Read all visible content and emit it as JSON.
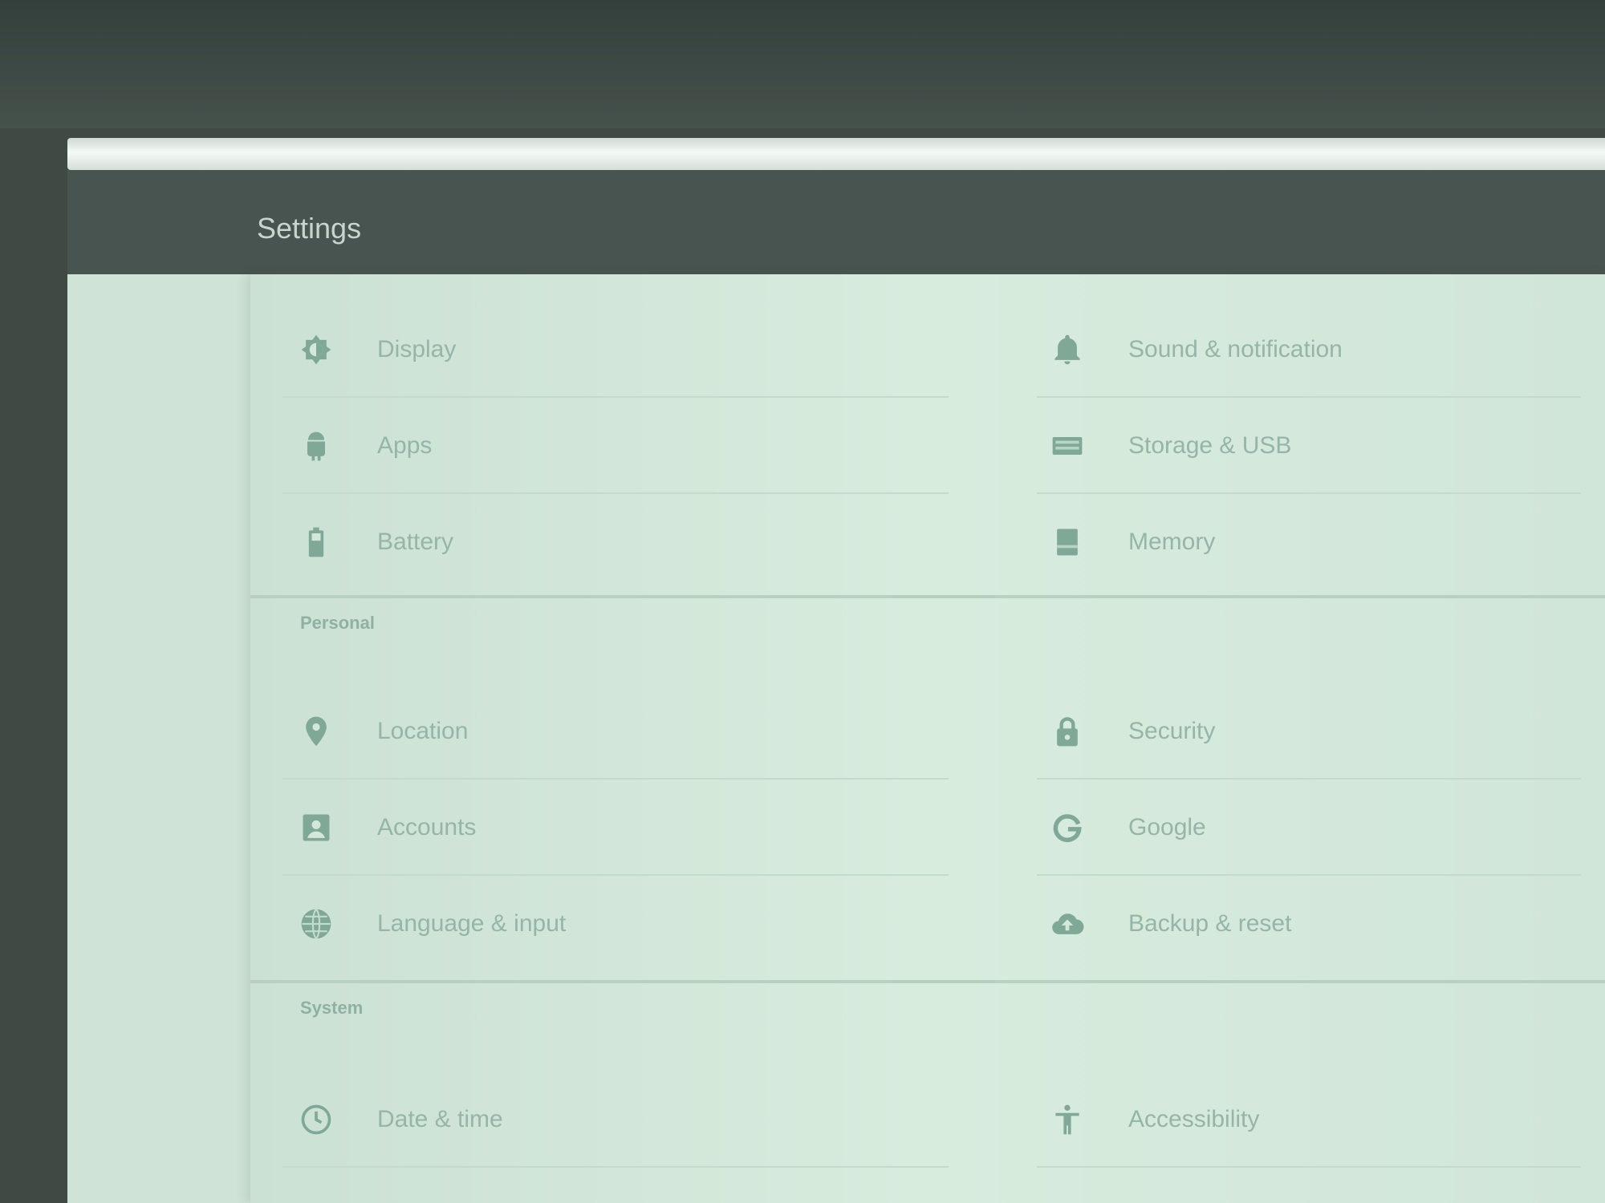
{
  "app": {
    "title": "Settings"
  },
  "sections": {
    "device": {
      "items": [
        {
          "label": "Display",
          "icon": "brightness-icon"
        },
        {
          "label": "Sound & notification",
          "icon": "bell-icon"
        },
        {
          "label": "Apps",
          "icon": "android-icon"
        },
        {
          "label": "Storage & USB",
          "icon": "storage-icon"
        },
        {
          "label": "Battery",
          "icon": "battery-icon"
        },
        {
          "label": "Memory",
          "icon": "memory-icon"
        }
      ]
    },
    "personal": {
      "header": "Personal",
      "items": [
        {
          "label": "Location",
          "icon": "location-icon"
        },
        {
          "label": "Security",
          "icon": "lock-icon"
        },
        {
          "label": "Accounts",
          "icon": "account-icon"
        },
        {
          "label": "Google",
          "icon": "google-icon"
        },
        {
          "label": "Language & input",
          "icon": "globe-icon"
        },
        {
          "label": "Backup & reset",
          "icon": "cloud-upload-icon"
        }
      ]
    },
    "system": {
      "header": "System",
      "items": [
        {
          "label": "Date & time",
          "icon": "clock-icon"
        },
        {
          "label": "Accessibility",
          "icon": "accessibility-icon"
        }
      ]
    }
  },
  "colors": {
    "accent": "#7fa896",
    "background": "#cfe3d6",
    "toolbar": "#48544f"
  }
}
